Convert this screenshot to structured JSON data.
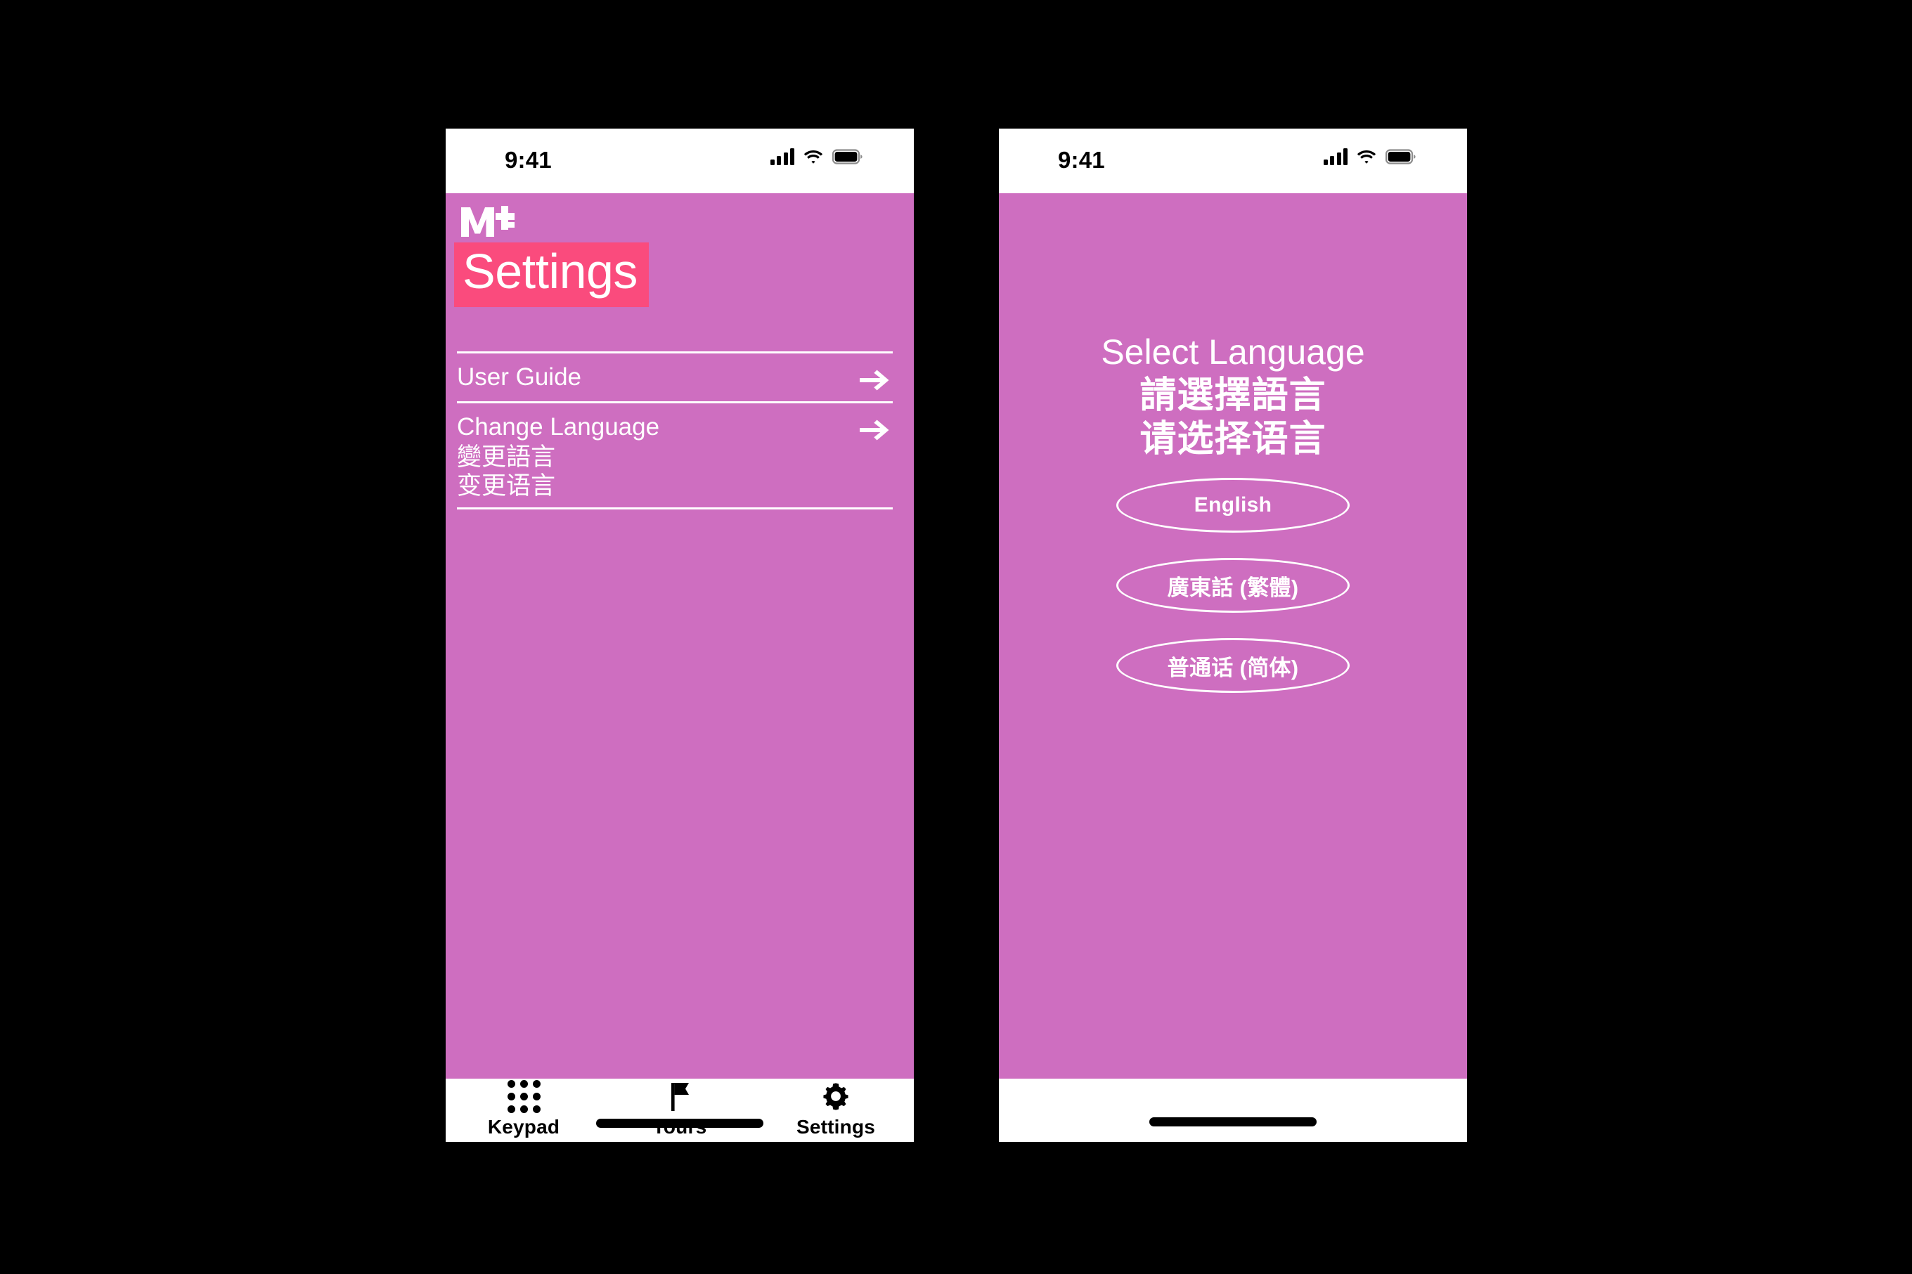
{
  "colors": {
    "background": "#000000",
    "screen_pink": "#CE6EC0",
    "highlight_pink": "#FA4B7D",
    "text_white": "#FFFFFF",
    "text_black": "#000000"
  },
  "status_bar": {
    "time": "9:41",
    "signal_icon": "cellular-signal-icon",
    "wifi_icon": "wifi-icon",
    "battery_icon": "battery-full-icon"
  },
  "settings_screen": {
    "brand_logo": "m-plus-logo",
    "page_title": "Settings",
    "rows": [
      {
        "label": "User Guide",
        "sublabels": [],
        "arrow_icon": "arrow-right-icon"
      },
      {
        "label": "Change Language",
        "sublabels": [
          "變更語言",
          "变更语言"
        ],
        "arrow_icon": "arrow-right-icon"
      }
    ],
    "tabs": [
      {
        "label": "Keypad",
        "icon": "keypad-grid-icon"
      },
      {
        "label": "Tours",
        "icon": "flag-icon"
      },
      {
        "label": "Settings",
        "icon": "gear-icon"
      }
    ]
  },
  "language_screen": {
    "headings": {
      "english": "Select Language",
      "traditional": "請選擇語言",
      "simplified": "请选择语言"
    },
    "options": [
      {
        "label": "English"
      },
      {
        "label": "廣東話 (繁體)"
      },
      {
        "label": "普通话 (简体)"
      }
    ]
  }
}
